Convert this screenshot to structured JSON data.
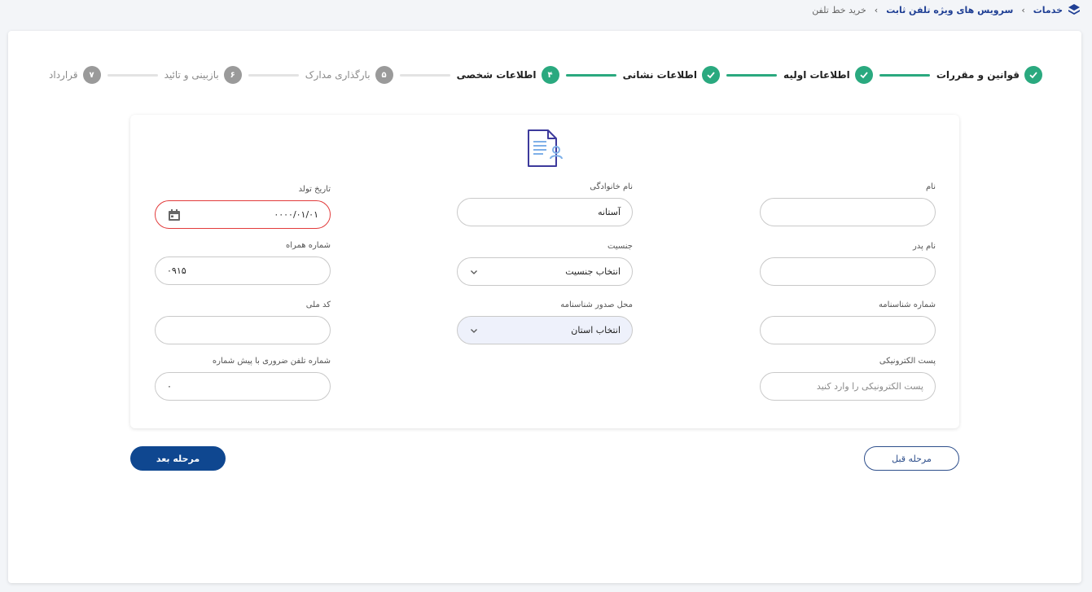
{
  "breadcrumb": {
    "items": [
      "خدمات",
      "سرویس های ویژه تلفن ثابت",
      "خرید خط تلفن"
    ],
    "logo_icon": "layers-icon",
    "separator_icon": "chevron-left-icon"
  },
  "stepper": {
    "steps": [
      {
        "label": "قوانین و مقررات",
        "badge": "",
        "status": "done"
      },
      {
        "label": "اطلاعات اولیه",
        "badge": "",
        "status": "done"
      },
      {
        "label": "اطلاعات نشانی",
        "badge": "",
        "status": "done"
      },
      {
        "label": "اطلاعات شخصی",
        "badge": "۴",
        "status": "current"
      },
      {
        "label": "بارگذاری مدارک",
        "badge": "۵",
        "status": "todo"
      },
      {
        "label": "بازبینی و تائید",
        "badge": "۶",
        "status": "todo"
      },
      {
        "label": "قرارداد",
        "badge": "۷",
        "status": "todo"
      }
    ],
    "accent": "#2aa97f",
    "inactive": "#9a9a9a"
  },
  "form": {
    "header_icon": "person-document-icon",
    "first_name": {
      "label": "نام",
      "value": ""
    },
    "last_name": {
      "label": "نام خانوادگی",
      "value": "آستانه"
    },
    "birth_date": {
      "label": "تاریخ تولد",
      "value": "۰۰۰۰/۰۱/۰۱",
      "icon": "calendar-icon"
    },
    "father_name": {
      "label": "نام پدر",
      "value": ""
    },
    "gender": {
      "label": "جنسیت",
      "value": "انتخاب جنسیت",
      "icon": "chevron-down-icon"
    },
    "mobile": {
      "label": "شماره همراه",
      "value": "۰۹۱۵"
    },
    "id_number": {
      "label": "شماره شناسنامه",
      "value": ""
    },
    "issue_place": {
      "label": "محل صدور شناسنامه",
      "value": "انتخاب استان",
      "icon": "chevron-down-icon"
    },
    "national_code": {
      "label": "کد ملی",
      "value": ""
    },
    "email": {
      "label": "پست الکترونیکی",
      "placeholder": "پست الکترونیکی را وارد کنید"
    },
    "emergency_phone": {
      "label": "شماره تلفن ضروری با پیش شماره",
      "value": "۰"
    }
  },
  "buttons": {
    "prev": "مرحله قبل",
    "next": "مرحله بعد"
  },
  "colors": {
    "primary": "#0f4790",
    "error": "#e23b3b"
  }
}
